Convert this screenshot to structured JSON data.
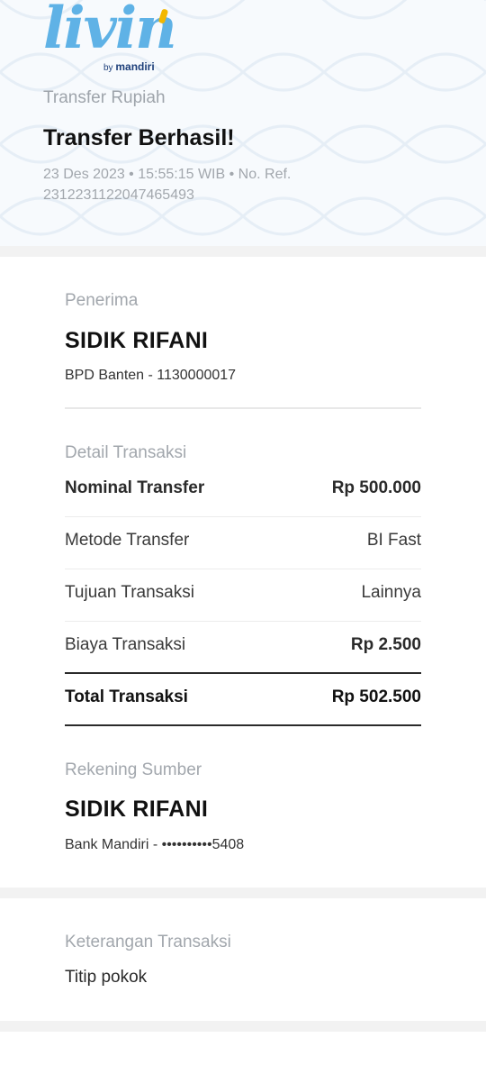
{
  "header": {
    "logo": {
      "wordmark": "livin",
      "by": "by",
      "brand": "mandiri"
    },
    "subtitle": "Transfer Rupiah",
    "title": "Transfer Berhasil!",
    "meta": "23 Des 2023 • 15:55:15 WIB • No. Ref. 2312231122047465493"
  },
  "recipient": {
    "label": "Penerima",
    "name": "SIDIK RIFANI",
    "account": "BPD Banten - 1130000017"
  },
  "details": {
    "label": "Detail Transaksi",
    "rows": [
      {
        "label": "Nominal Transfer",
        "value": "Rp 500.000"
      },
      {
        "label": "Metode Transfer",
        "value": "BI Fast"
      },
      {
        "label": "Tujuan Transaksi",
        "value": "Lainnya"
      },
      {
        "label": "Biaya Transaksi",
        "value": "Rp 2.500"
      }
    ],
    "total": {
      "label": "Total Transaksi",
      "value": "Rp 502.500"
    }
  },
  "source": {
    "label": "Rekening Sumber",
    "name": "SIDIK RIFANI",
    "account": "Bank Mandiri - ••••••••••5408"
  },
  "note": {
    "label": "Keterangan Transaksi",
    "text": "Titip pokok"
  },
  "colors": {
    "brand_blue": "#5fb2e6",
    "brand_yellow": "#f2b700",
    "brand_navy": "#1d3f7a"
  }
}
